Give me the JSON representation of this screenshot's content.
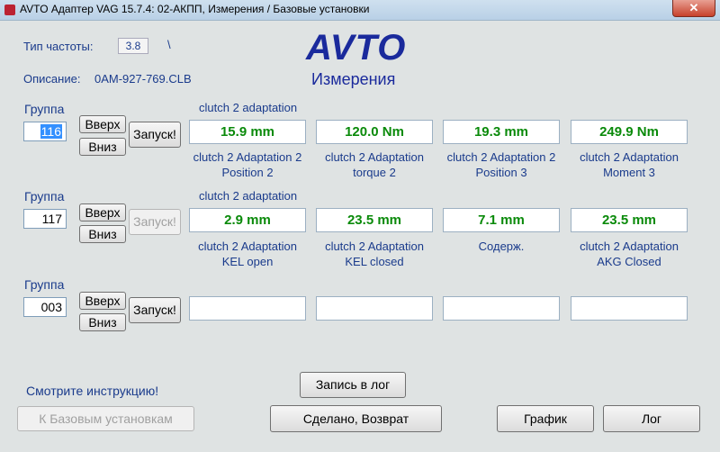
{
  "window": {
    "title": "AVTO Адаптер VAG 15.7.4: 02-АКПП,  Измерения / Базовые установки",
    "close": "✕"
  },
  "header": {
    "freq_label": "Тип частоты:",
    "freq_value": "3.8",
    "freq_mark": "\\",
    "desc_label": "Описание:",
    "desc_value": "0AM-927-769.CLB",
    "logo": "AVTO",
    "logo_sub": "Измерения"
  },
  "labels": {
    "group": "Группа",
    "up": "Вверх",
    "down": "Вниз",
    "run": "Запуск!"
  },
  "groups": [
    {
      "number_selected": "116",
      "header": "clutch 2 adaptation",
      "values": [
        "15.9 mm",
        "120.0 Nm",
        "19.3 mm",
        "249.9 Nm"
      ],
      "captions": [
        [
          "clutch 2 Adaptation 2",
          "Position 2"
        ],
        [
          "clutch 2 Adaptation",
          "torque 2"
        ],
        [
          "clutch 2 Adaptation 2",
          "Position 3"
        ],
        [
          "clutch 2 Adaptation",
          "Moment 3"
        ]
      ]
    },
    {
      "number": "117",
      "header": "clutch 2 adaptation",
      "values": [
        "2.9 mm",
        "23.5 mm",
        "7.1 mm",
        "23.5 mm"
      ],
      "captions": [
        [
          "clutch 2 Adaptation",
          "KEL open"
        ],
        [
          "clutch 2 Adaptation",
          "KEL closed"
        ],
        [
          "Содерж.",
          ""
        ],
        [
          "clutch 2 Adaptation",
          "AKG Closed"
        ]
      ]
    },
    {
      "number": "003",
      "header": "",
      "values": [
        "",
        "",
        "",
        ""
      ],
      "captions": [
        [
          "",
          ""
        ],
        [
          "",
          ""
        ],
        [
          "",
          ""
        ],
        [
          "",
          ""
        ]
      ]
    }
  ],
  "footer": {
    "instructions_link": "Смотрите инструкцию!",
    "basic_settings": "К Базовым установкам",
    "log_record": "Запись в лог",
    "done_return": "Сделано, Возврат",
    "graph": "График",
    "log": "Лог"
  },
  "colors": {
    "label_blue": "#1a3b8c",
    "value_green": "#0a8a0a",
    "logo_blue": "#1a2a9c"
  }
}
